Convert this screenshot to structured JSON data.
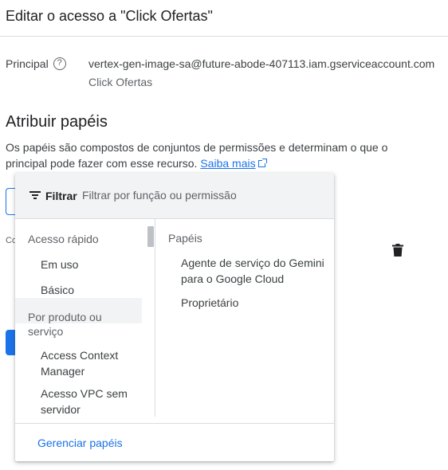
{
  "dialog": {
    "title": "Editar o acesso a \"Click Ofertas\""
  },
  "principal": {
    "label": "Principal",
    "help_glyph": "?",
    "value": "vertex-gen-image-sa@future-abode-407113.iam.gserviceaccount.com",
    "subtext": "Click Ofertas"
  },
  "roles_section": {
    "heading": "Atribuir papéis",
    "description": "Os papéis são compostos de conjuntos de permissões e determinam o que o principal pode fazer com esse recurso.",
    "learn_more": "Saiba mais",
    "condition_fragment": "Co"
  },
  "role_picker": {
    "filter_label": "Filtrar",
    "filter_placeholder": "Filtrar por função ou permissão",
    "left_groups": [
      {
        "heading": "Acesso rápido",
        "options": [
          "Em uso",
          "Básico"
        ]
      },
      {
        "heading": "Por produto ou serviço",
        "options": [
          "Access Context Manager",
          "Acesso VPC sem servidor"
        ]
      }
    ],
    "roles_heading": "Papéis",
    "roles": [
      "Agente de serviço do Gemini para o Google Cloud",
      "Proprietário"
    ],
    "manage_roles": "Gerenciar papéis"
  },
  "colors": {
    "accent": "#1a73e8",
    "text": "#202124",
    "muted": "#5f6368",
    "filter_bg": "#f1f3f4"
  }
}
